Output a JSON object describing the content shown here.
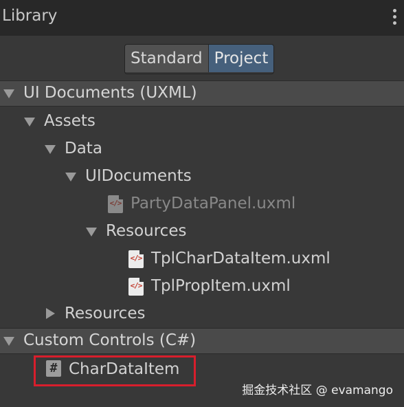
{
  "header": {
    "title": "Library"
  },
  "toggle": {
    "options": [
      "Standard",
      "Project"
    ],
    "selected": "Project"
  },
  "sections": {
    "uxml": {
      "label": "UI Documents (UXML)"
    },
    "csharp": {
      "label": "Custom Controls (C#)"
    }
  },
  "tree": {
    "assets": "Assets",
    "data": "Data",
    "uidocuments": "UIDocuments",
    "party_panel": "PartyDataPanel.uxml",
    "resources_inner": "Resources",
    "tpl_char": "TplCharDataItem.uxml",
    "tpl_prop": "TplPropItem.uxml",
    "resources_outer": "Resources"
  },
  "controls": {
    "char_data_item": "CharDataItem"
  },
  "icons": {
    "uxml_file": "uxml-file-icon",
    "csharp_script": "hash-icon",
    "code_glyph": "</>",
    "hash_glyph": "#"
  },
  "watermark": "掘金技术社区 @ evamango",
  "colors": {
    "accent": "#46607c",
    "highlight": "#d81e2c"
  }
}
